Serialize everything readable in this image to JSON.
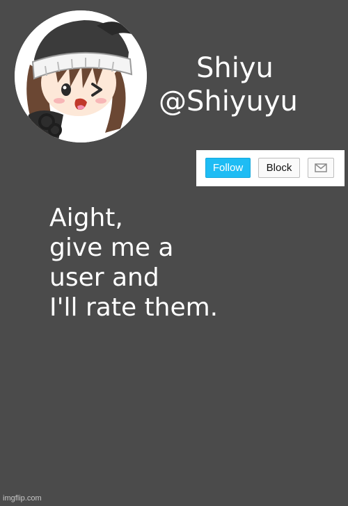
{
  "profile": {
    "display_name": "Shiyu",
    "handle": "@Shiyuyu",
    "avatar_icon": "anime-girl-avatar"
  },
  "actions": {
    "follow_label": "Follow",
    "block_label": "Block",
    "message_icon": "envelope-icon"
  },
  "post": {
    "lines": [
      "Aight,",
      "give me a",
      "user and",
      "I'll rate them."
    ]
  },
  "watermark": {
    "text": "imgflip.com"
  },
  "colors": {
    "background": "#4b4b4b",
    "follow_button": "#1ebcf4",
    "text": "#ffffff"
  }
}
